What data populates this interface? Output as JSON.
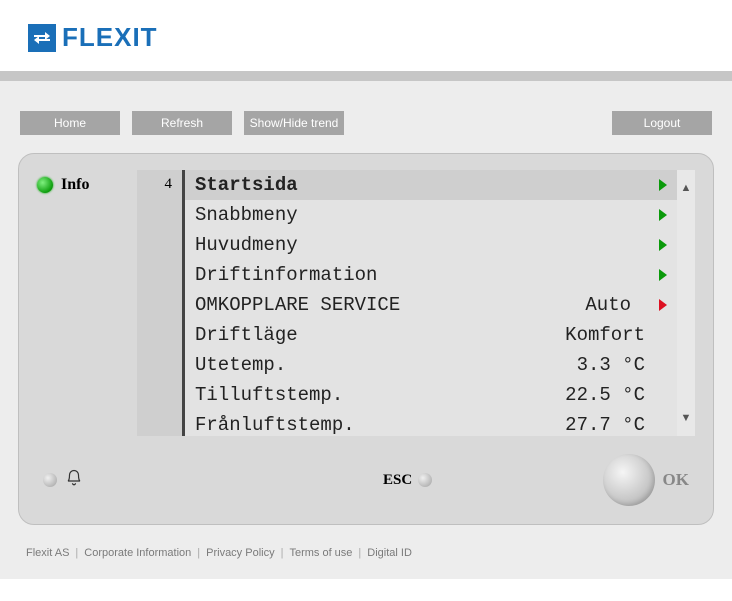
{
  "logo": {
    "text": "FLEXIT",
    "trademark": "."
  },
  "buttons": {
    "home": "Home",
    "refresh": "Refresh",
    "showhide": "Show/Hide trend",
    "logout": "Logout"
  },
  "panel": {
    "info_label": "Info",
    "page_number": "4",
    "esc_label": "ESC",
    "ok_label": "OK"
  },
  "menu": {
    "header": "Startsida",
    "items": [
      {
        "label": "Snabbmeny",
        "value": "",
        "nav": "green"
      },
      {
        "label": "Huvudmeny",
        "value": "",
        "nav": "green"
      },
      {
        "label": "Driftinformation",
        "value": "",
        "nav": "green"
      },
      {
        "label": "OMKOPPLARE SERVICE",
        "value": "Auto",
        "nav": "red"
      },
      {
        "label": "Driftläge",
        "value": "Komfort",
        "nav": ""
      },
      {
        "label": "Utetemp.",
        "value": "3.3 °C",
        "nav": ""
      },
      {
        "label": "Tilluftstemp.",
        "value": "22.5 °C",
        "nav": ""
      },
      {
        "label": "Frånluftstemp.",
        "value": "27.7 °C",
        "nav": ""
      }
    ]
  },
  "footer": {
    "items": [
      "Flexit AS",
      "Corporate Information",
      "Privacy Policy",
      "Terms of use",
      "Digital ID"
    ]
  }
}
